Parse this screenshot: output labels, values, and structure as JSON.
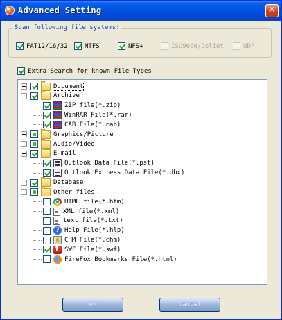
{
  "window": {
    "title": "Advanced Setting",
    "close_glyph": "✕"
  },
  "file_systems": {
    "legend": "Scan following file systems:",
    "items": [
      {
        "label": "FAT12/16/32",
        "checked": true,
        "enabled": true
      },
      {
        "label": "NTFS",
        "checked": true,
        "enabled": true
      },
      {
        "label": "NFS+",
        "checked": true,
        "enabled": true
      },
      {
        "label": "ISO9660/Joliet",
        "checked": false,
        "enabled": false
      },
      {
        "label": "UDF",
        "checked": false,
        "enabled": false
      }
    ]
  },
  "extra_search": {
    "label": "Extra Search for known File Types",
    "checked": true
  },
  "tree": {
    "rows": [
      {
        "label": "Document",
        "level": 0,
        "state": "checked",
        "icon": "folder-icon",
        "expander": "plus",
        "selected": true
      },
      {
        "label": "Archive",
        "level": 0,
        "state": "checked",
        "icon": "folder-icon",
        "expander": "minus"
      },
      {
        "label": "ZIP file(*.zip)",
        "level": 1,
        "state": "checked",
        "icon": "archive-icon"
      },
      {
        "label": "WinRAR File(*.rar)",
        "level": 1,
        "state": "checked",
        "icon": "archive-icon"
      },
      {
        "label": "CAB File(*.cab)",
        "level": 1,
        "state": "checked",
        "icon": "archive-icon"
      },
      {
        "label": "Graphics/Picture",
        "level": 0,
        "state": "partial",
        "icon": "folder-icon",
        "expander": "plus"
      },
      {
        "label": "Audio/Video",
        "level": 0,
        "state": "partial",
        "icon": "folder-icon",
        "expander": "plus"
      },
      {
        "label": "E-mail",
        "level": 0,
        "state": "checked",
        "icon": "folder-icon",
        "expander": "minus"
      },
      {
        "label": "Outlook Data File(*.pst)",
        "level": 1,
        "state": "checked",
        "icon": "mail-icon"
      },
      {
        "label": "Outlook Express Data File(*.dbx)",
        "level": 1,
        "state": "checked",
        "icon": "mail-icon"
      },
      {
        "label": "Database",
        "level": 0,
        "state": "checked",
        "icon": "folder-icon",
        "expander": "plus"
      },
      {
        "label": "Other files",
        "level": 0,
        "state": "partial",
        "icon": "folder-icon",
        "expander": "minus"
      },
      {
        "label": "HTML file(*.htm)",
        "level": 1,
        "state": "unchecked",
        "icon": "chrome-icon"
      },
      {
        "label": "XML file(*.xml)",
        "level": 1,
        "state": "unchecked",
        "icon": "doc-icon"
      },
      {
        "label": "text file(*.txt)",
        "level": 1,
        "state": "unchecked",
        "icon": "doc-icon"
      },
      {
        "label": "Help File(*.hlp)",
        "level": 1,
        "state": "unchecked",
        "icon": "help-icon",
        "icon_glyph": "?"
      },
      {
        "label": "CHM File(*.chm)",
        "level": 1,
        "state": "unchecked",
        "icon": "chm-icon"
      },
      {
        "label": "SWF File(*.swf)",
        "level": 1,
        "state": "checked",
        "icon": "swf-icon"
      },
      {
        "label": "FireFox Bookmarks File(*.html)",
        "level": 1,
        "state": "unchecked",
        "icon": "firefox-icon"
      }
    ]
  },
  "buttons": {
    "ok": "OK",
    "cancel": "Cancel"
  }
}
